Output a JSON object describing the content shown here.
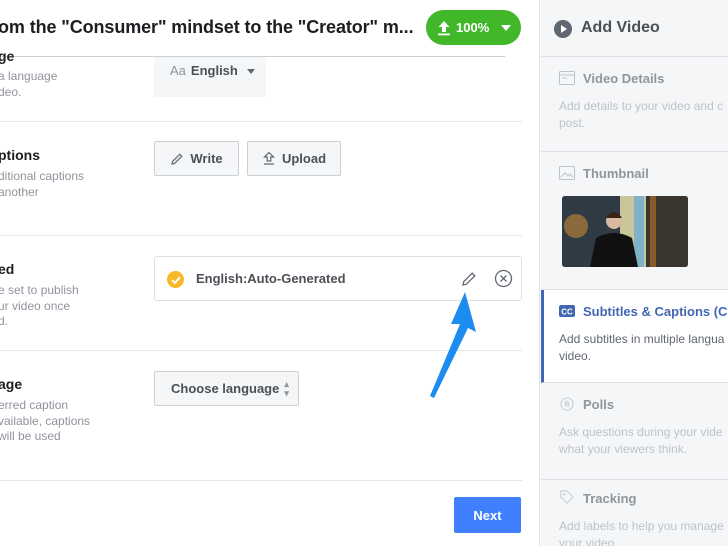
{
  "header": {
    "title": "om the \"Consumer\" mindset to the \"Creator\" m...",
    "upload_progress_label": "100%",
    "upload_progress_value": 100,
    "accent_color": "#42b72a"
  },
  "sections": {
    "video_language": {
      "label": "ge",
      "desc": "a language\ndeo.",
      "select_prefix": "Aa",
      "select_value": "English"
    },
    "upload_captions": {
      "label": "ptions",
      "desc": "ditional captions\nanother",
      "write_label": "Write",
      "upload_label": "Upload"
    },
    "published": {
      "label": "ed",
      "desc": "e set to publish\nur video once\nd.",
      "caption_item": "English:Auto-Generated"
    },
    "default_language": {
      "label": "age",
      "desc": "erred caption\nvailable, captions\nwill be used",
      "select_label": "Choose language"
    }
  },
  "footer": {
    "next_label": "Next",
    "next_color": "#4080ff"
  },
  "sidebar": {
    "title": "Add Video",
    "steps": [
      {
        "title": "Video Details",
        "desc": "Add details to your video and c\npost.",
        "icon": "details-icon"
      },
      {
        "title": "Thumbnail",
        "icon": "image-icon"
      },
      {
        "title": "Subtitles & Captions (CC)",
        "desc": "Add subtitles in multiple langua\nvideo.",
        "icon": "cc-icon",
        "active": true
      },
      {
        "title": "Polls",
        "desc": "Ask questions during your vide\nwhat your viewers think.",
        "icon": "polls-icon"
      },
      {
        "title": "Tracking",
        "desc": "Add labels to help you manage\nyour video.",
        "icon": "tag-icon"
      }
    ],
    "active_color": "#4267b2"
  }
}
